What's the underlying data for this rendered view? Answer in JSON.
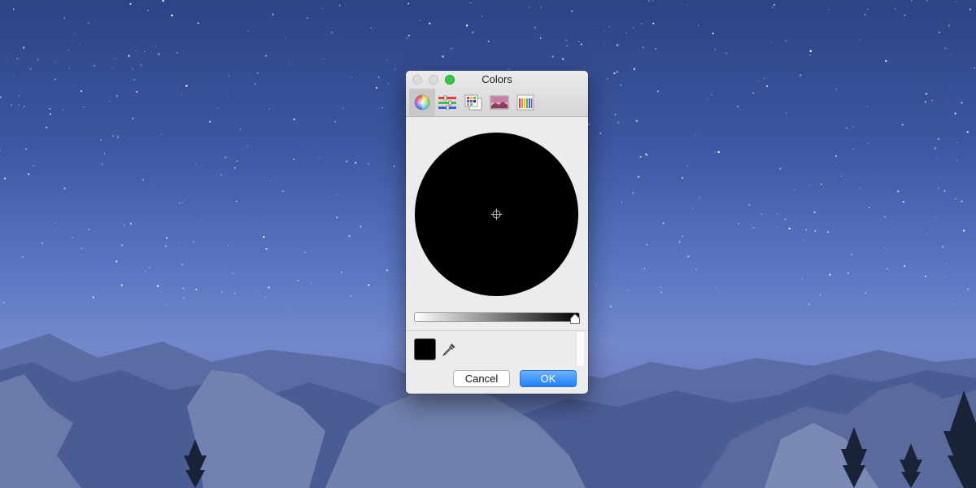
{
  "window": {
    "title": "Colors"
  },
  "toolbar": {
    "items": [
      {
        "name": "color-wheel",
        "icon": "color-wheel-icon",
        "active": true
      },
      {
        "name": "color-sliders",
        "icon": "sliders-icon",
        "active": false
      },
      {
        "name": "color-palettes",
        "icon": "palette-icon",
        "active": false
      },
      {
        "name": "image-palettes",
        "icon": "image-palette-icon",
        "active": false
      },
      {
        "name": "pencils",
        "icon": "pencils-icon",
        "active": false
      }
    ]
  },
  "picker": {
    "wheel_color": "#000000",
    "brightness_level": 0,
    "current_color": "#000000"
  },
  "buttons": {
    "cancel": "Cancel",
    "ok": "OK"
  },
  "colors": {
    "accent": "#1e7ff7",
    "zoom_button": "#34c748"
  }
}
